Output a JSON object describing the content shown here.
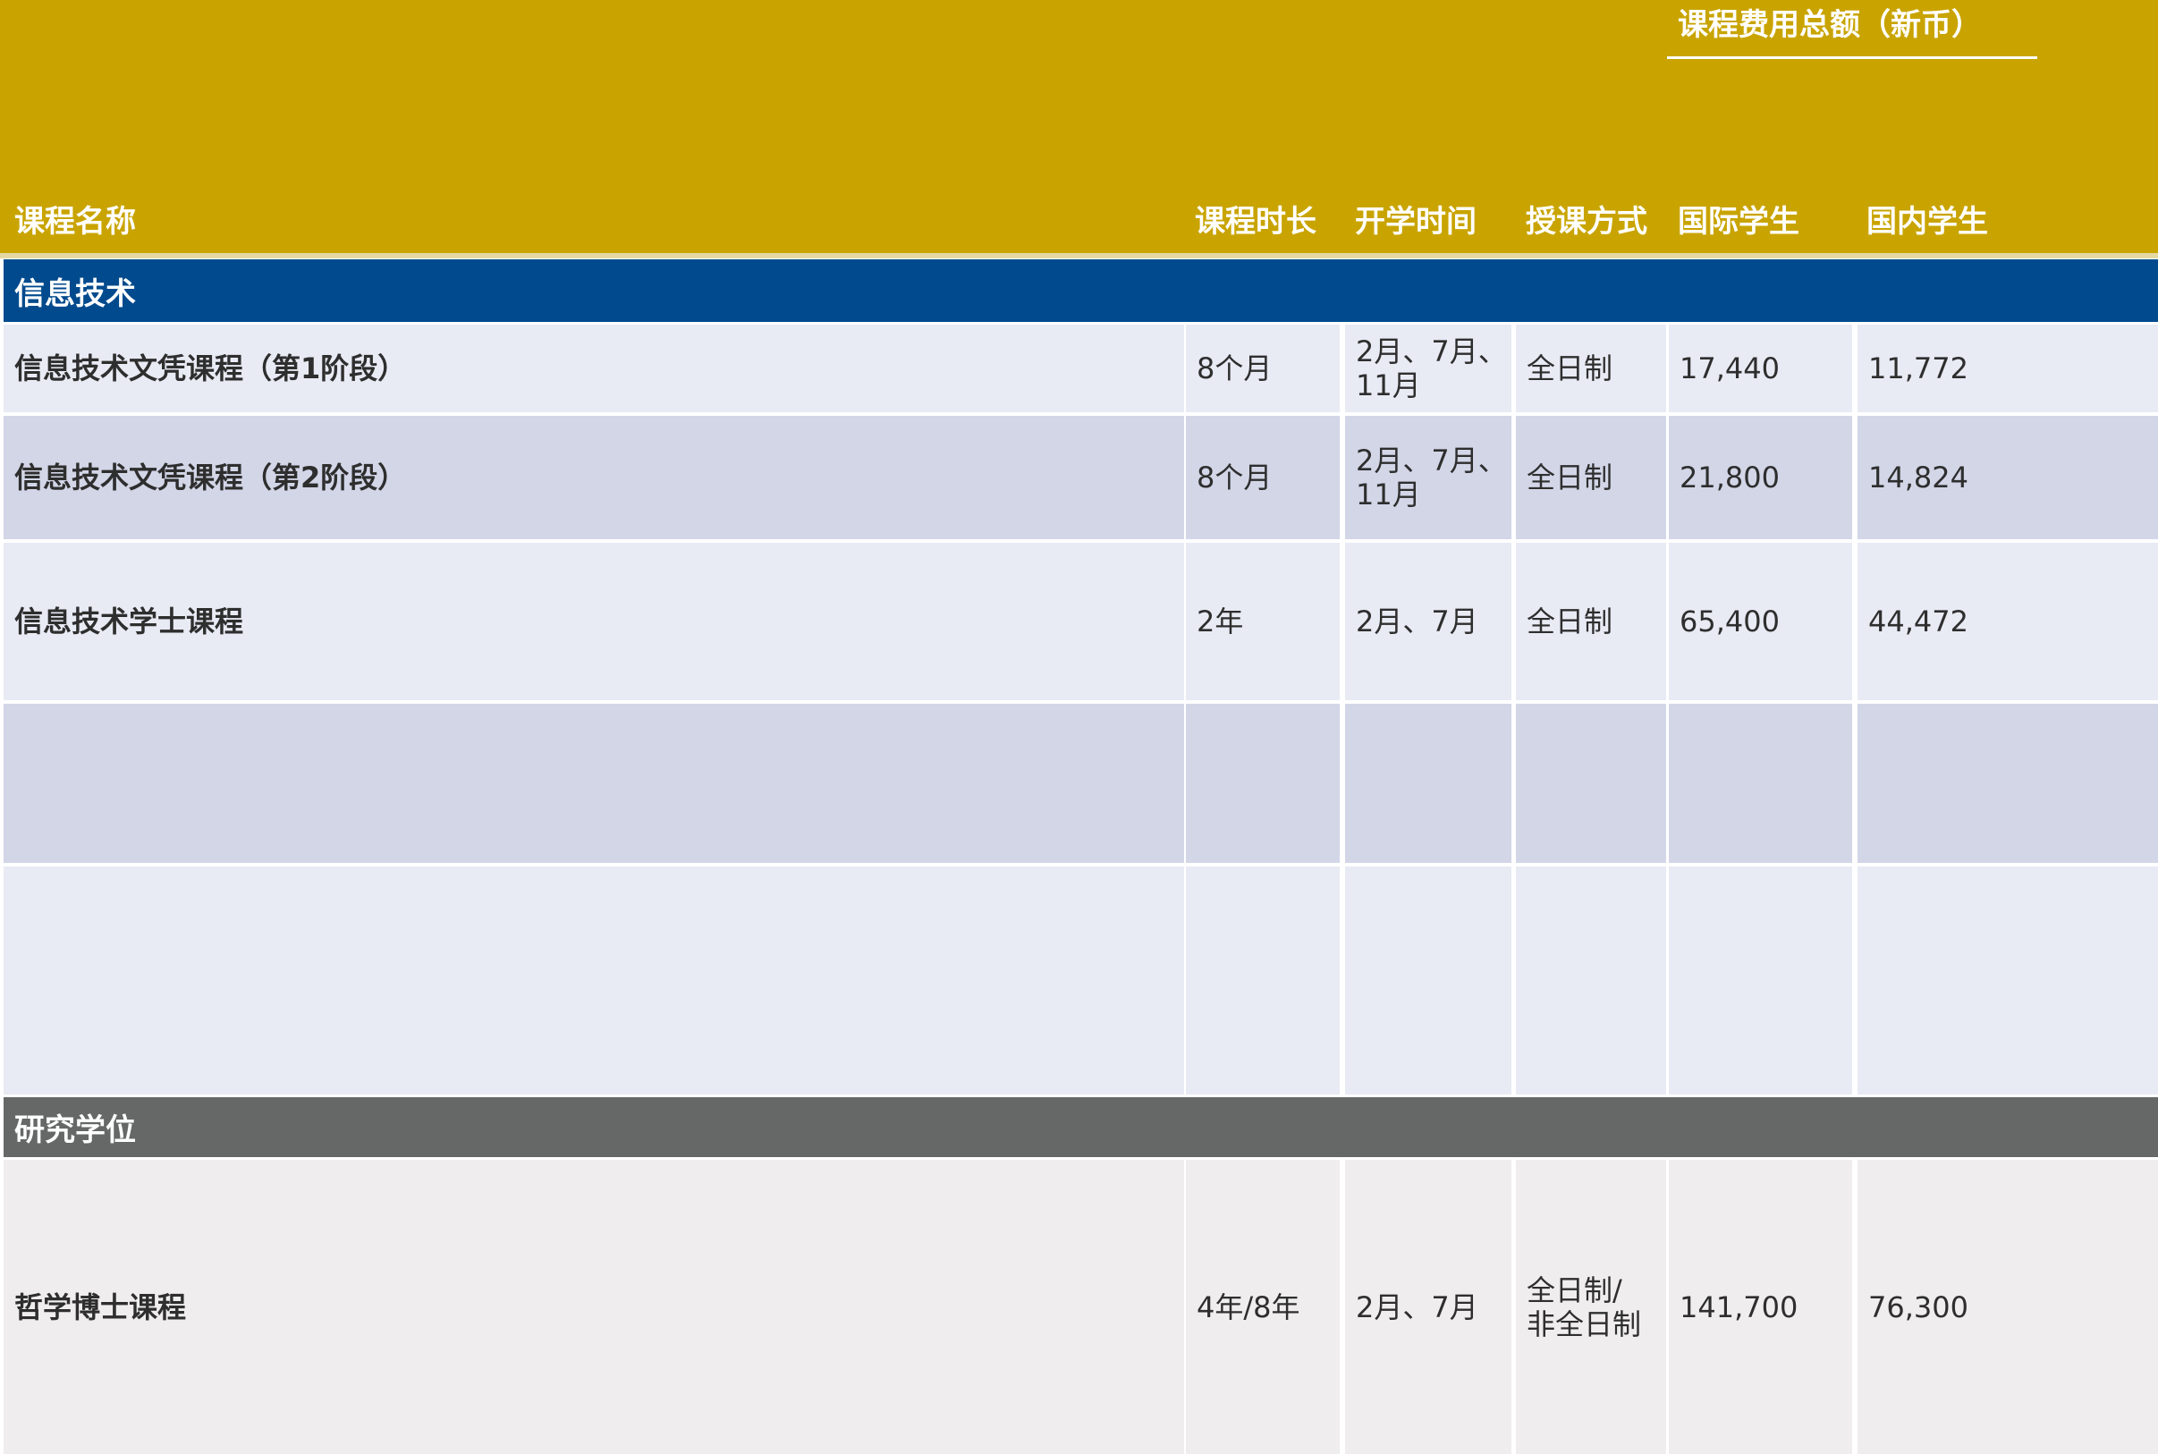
{
  "header": {
    "fee_group_title": "课程费用总额（新币）",
    "columns": {
      "name": "课程名称",
      "duration": "课程时长",
      "intake": "开学时间",
      "mode": "授课方式",
      "intl": "国际学生",
      "local": "国内学生"
    }
  },
  "sections": [
    {
      "title": "信息技术",
      "rows": [
        {
          "name": "信息技术文凭课程（第1阶段）",
          "duration": "8个月",
          "intake": "2月、7月、\n11月",
          "mode": "全日制",
          "intl": "17,440",
          "local": "11,772"
        },
        {
          "name": "信息技术文凭课程（第2阶段）",
          "duration": "8个月",
          "intake": "2月、7月、\n11月",
          "mode": "全日制",
          "intl": "21,800",
          "local": "14,824"
        },
        {
          "name": "信息技术学士课程",
          "duration": "2年",
          "intake": "2月、7月",
          "mode": "全日制",
          "intl": "65,400",
          "local": "44,472"
        },
        {
          "name": "",
          "duration": "",
          "intake": "",
          "mode": "",
          "intl": "",
          "local": ""
        },
        {
          "name": "",
          "duration": "",
          "intake": "",
          "mode": "",
          "intl": "",
          "local": ""
        }
      ]
    },
    {
      "title": "研究学位",
      "rows": [
        {
          "name": "哲学博士课程",
          "duration": "4年/8年",
          "intake": "2月、7月",
          "mode": "全日制/\n非全日制",
          "intl": "141,700",
          "local": "76,300"
        }
      ]
    }
  ],
  "colors": {
    "gold": "#c9a400",
    "it_band": "#004a8d",
    "research_band": "#666868",
    "row_light_blue": "#e8eaf4",
    "row_dark_blue": "#d2d6e7",
    "row_grey": "#efedee"
  }
}
